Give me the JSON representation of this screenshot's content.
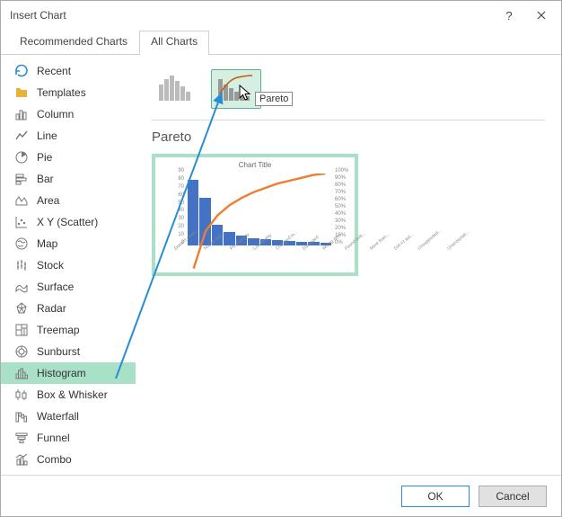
{
  "dialog": {
    "title": "Insert Chart"
  },
  "tabs": {
    "recommended": "Recommended Charts",
    "all": "All Charts"
  },
  "sidebar": {
    "items": [
      {
        "label": "Recent"
      },
      {
        "label": "Templates"
      },
      {
        "label": "Column"
      },
      {
        "label": "Line"
      },
      {
        "label": "Pie"
      },
      {
        "label": "Bar"
      },
      {
        "label": "Area"
      },
      {
        "label": "X Y (Scatter)"
      },
      {
        "label": "Map"
      },
      {
        "label": "Stock"
      },
      {
        "label": "Surface"
      },
      {
        "label": "Radar"
      },
      {
        "label": "Treemap"
      },
      {
        "label": "Sunburst"
      },
      {
        "label": "Histogram"
      },
      {
        "label": "Box & Whisker"
      },
      {
        "label": "Waterfall"
      },
      {
        "label": "Funnel"
      },
      {
        "label": "Combo"
      }
    ]
  },
  "content": {
    "tooltip": "Pareto",
    "section_title": "Pareto"
  },
  "chart_data": {
    "type": "bar",
    "title": "Chart Title",
    "categories": [
      "Doesn't meet...",
      "Not as des...",
      "Poor quality",
      "Low quality",
      "Changed m...",
      "Damaged",
      "Wrong item",
      "Found bett...",
      "More than...",
      "Did n't aut...",
      "Unsupported...",
      "Unacceptab..."
    ],
    "values": [
      82,
      60,
      26,
      17,
      12,
      9,
      8,
      7,
      6,
      5,
      4,
      3
    ],
    "cumulative_pct": [
      34,
      60,
      71,
      78,
      83,
      87,
      90,
      93,
      95,
      97,
      99,
      100
    ],
    "ylim": [
      0,
      90
    ],
    "y2lim": [
      0,
      100
    ],
    "yticks": [
      0,
      10,
      20,
      30,
      40,
      50,
      60,
      70,
      80,
      90
    ],
    "y2ticks": [
      "0%",
      "10%",
      "20%",
      "30%",
      "40%",
      "50%",
      "60%",
      "70%",
      "80%",
      "90%",
      "100%"
    ]
  },
  "footer": {
    "ok": "OK",
    "cancel": "Cancel"
  }
}
